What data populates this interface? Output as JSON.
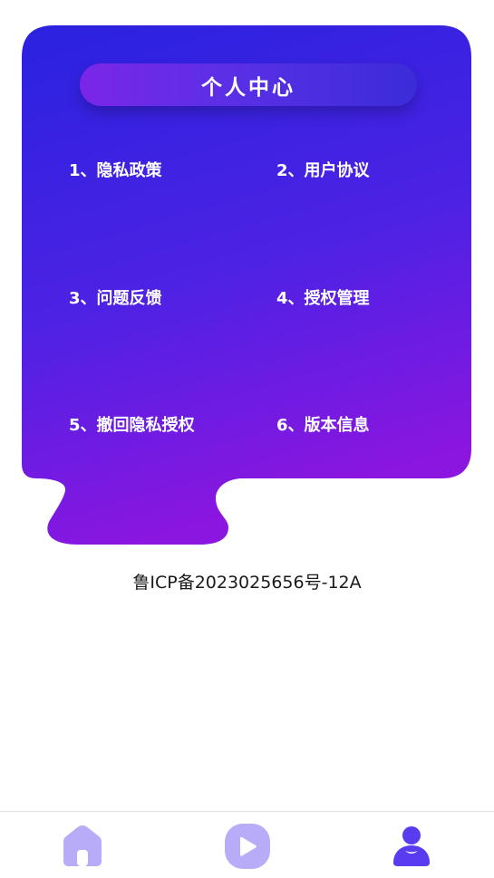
{
  "header": {
    "title": "个人中心"
  },
  "menu": {
    "items": [
      {
        "label": "1、隐私政策"
      },
      {
        "label": "2、用户协议"
      },
      {
        "label": "3、问题反馈"
      },
      {
        "label": "4、授权管理"
      },
      {
        "label": "5、撤回隐私授权"
      },
      {
        "label": "6、版本信息"
      }
    ]
  },
  "footer": {
    "icp": "鲁ICP备2023025656号-12A"
  },
  "tabbar": {
    "tabs": [
      {
        "icon": "home-icon",
        "active": false
      },
      {
        "icon": "play-icon",
        "active": false
      },
      {
        "icon": "user-icon",
        "active": true
      }
    ]
  },
  "colors": {
    "gradient_top": "#2a22e0",
    "gradient_bottom": "#8a16e0",
    "tab_inactive": "#b8abf7",
    "tab_active": "#5a3cf0"
  }
}
